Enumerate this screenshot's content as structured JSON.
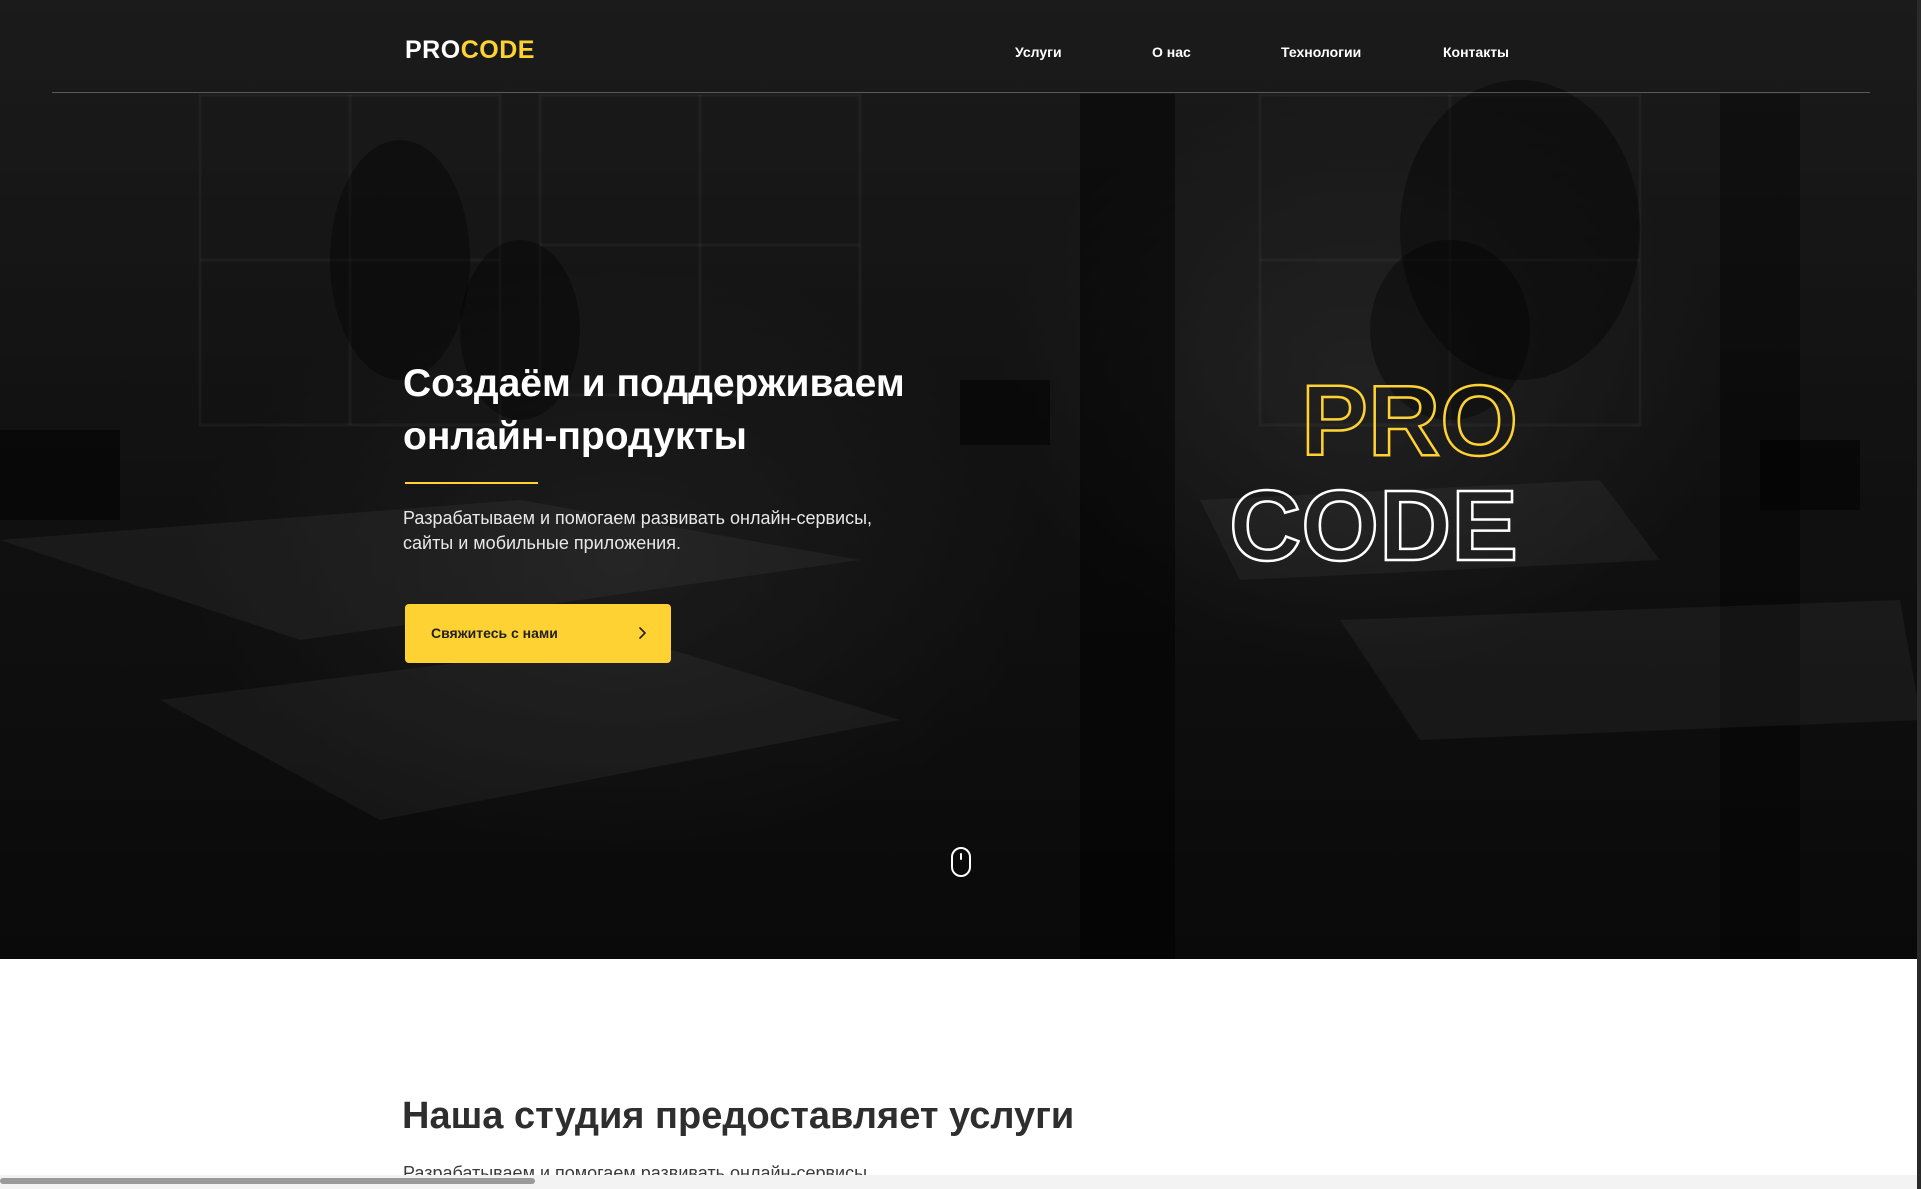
{
  "brand": {
    "logo_pro": "PRO",
    "logo_code": "CODE"
  },
  "nav": {
    "items": [
      {
        "label": "Услуги"
      },
      {
        "label": "О нас"
      },
      {
        "label": "Технологии"
      },
      {
        "label": "Контакты"
      }
    ]
  },
  "hero": {
    "headline": "Создаём и поддерживаем онлайн-продукты",
    "subtitle": "Разрабатываем и помогаем развивать онлайн-сервисы,\nсайты и мобильные приложения.",
    "cta_label": "Свяжитесь с нами",
    "big_logo_top": "PRO",
    "big_logo_bottom": "CODE"
  },
  "services": {
    "title": "Наша студия предоставляет услуги",
    "subtitle": "Разрабатываем и помогаем развивать онлайн-сервисы,"
  },
  "colors": {
    "accent": "#ffd233",
    "hero_bg": "#1a1a1a",
    "text_dark": "#2e2e2e"
  },
  "icons": {
    "cta_arrow": "chevron-right-icon",
    "scroll": "mouse-scroll-icon"
  }
}
